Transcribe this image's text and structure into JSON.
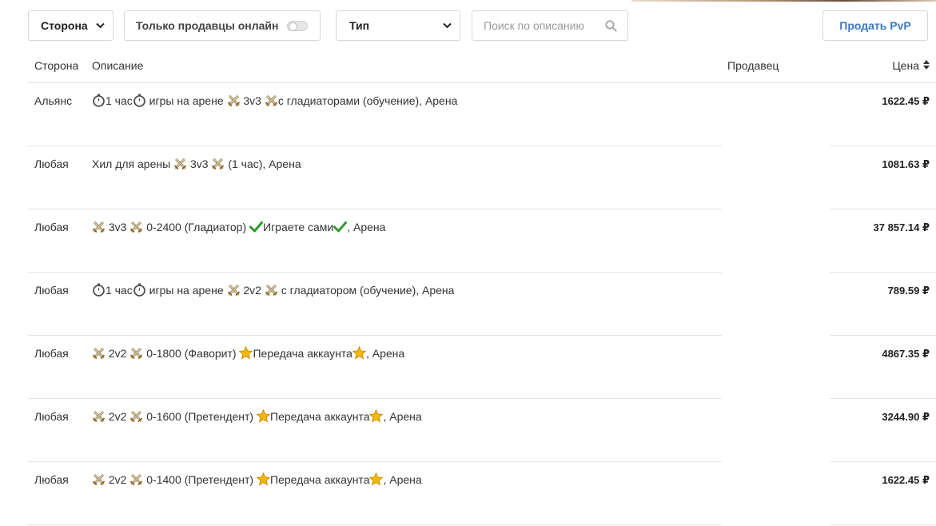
{
  "toolbar": {
    "side_select": "Сторона",
    "online_label": "Только продавцы онлайн",
    "online_enabled": false,
    "type_select": "Тип",
    "search_placeholder": "Поиск по описанию",
    "sell_button": "Продать PvP"
  },
  "table": {
    "headers": {
      "side": "Сторона",
      "description": "Описание",
      "seller": "Продавец",
      "price": "Цена"
    },
    "rows": [
      {
        "side": "Альянс",
        "price": "1622.45 ₽",
        "desc": [
          {
            "icon": "stopwatch"
          },
          {
            "text": "1 час"
          },
          {
            "icon": "stopwatch"
          },
          {
            "text": " игры на арене "
          },
          {
            "icon": "crossed-swords"
          },
          {
            "text": " 3v3 "
          },
          {
            "icon": "crossed-swords"
          },
          {
            "text": "с гладиаторами (обучение), Арена"
          }
        ]
      },
      {
        "side": "Любая",
        "price": "1081.63 ₽",
        "desc": [
          {
            "text": "Хил для арены "
          },
          {
            "icon": "crossed-swords"
          },
          {
            "text": " 3v3 "
          },
          {
            "icon": "crossed-swords"
          },
          {
            "text": " (1 час), Арена"
          }
        ]
      },
      {
        "side": "Любая",
        "price": "37 857.14 ₽",
        "desc": [
          {
            "icon": "crossed-swords"
          },
          {
            "text": " 3v3 "
          },
          {
            "icon": "crossed-swords"
          },
          {
            "text": " 0-2400 (Гладиатор) "
          },
          {
            "icon": "check"
          },
          {
            "text": "Играете сами"
          },
          {
            "icon": "check"
          },
          {
            "text": ", Арена"
          }
        ]
      },
      {
        "side": "Любая",
        "price": "789.59 ₽",
        "desc": [
          {
            "icon": "stopwatch"
          },
          {
            "text": "1 час"
          },
          {
            "icon": "stopwatch"
          },
          {
            "text": " игры на арене "
          },
          {
            "icon": "crossed-swords"
          },
          {
            "text": " 2v2 "
          },
          {
            "icon": "crossed-swords"
          },
          {
            "text": " с гладиатором (обучение), Арена"
          }
        ]
      },
      {
        "side": "Любая",
        "price": "4867.35 ₽",
        "desc": [
          {
            "icon": "crossed-swords"
          },
          {
            "text": " 2v2 "
          },
          {
            "icon": "crossed-swords"
          },
          {
            "text": " 0-1800 (Фаворит) "
          },
          {
            "icon": "star"
          },
          {
            "text": "Передача аккаунта"
          },
          {
            "icon": "star"
          },
          {
            "text": ", Арена"
          }
        ]
      },
      {
        "side": "Любая",
        "price": "3244.90 ₽",
        "desc": [
          {
            "icon": "crossed-swords"
          },
          {
            "text": " 2v2 "
          },
          {
            "icon": "crossed-swords"
          },
          {
            "text": " 0-1600 (Претендент) "
          },
          {
            "icon": "star"
          },
          {
            "text": "Передача аккаунта"
          },
          {
            "icon": "star"
          },
          {
            "text": ", Арена"
          }
        ]
      },
      {
        "side": "Любая",
        "price": "1622.45 ₽",
        "desc": [
          {
            "icon": "crossed-swords"
          },
          {
            "text": " 2v2 "
          },
          {
            "icon": "crossed-swords"
          },
          {
            "text": " 0-1400 (Претендент) "
          },
          {
            "icon": "star"
          },
          {
            "text": "Передача аккаунта"
          },
          {
            "icon": "star"
          },
          {
            "text": ", Арена"
          }
        ]
      }
    ]
  },
  "colors": {
    "accent": "#3b78c3",
    "row_divider": "#e5e5e5",
    "check": "#2e9b2e",
    "star": "#f5b800",
    "swords": "#c9a45c"
  }
}
